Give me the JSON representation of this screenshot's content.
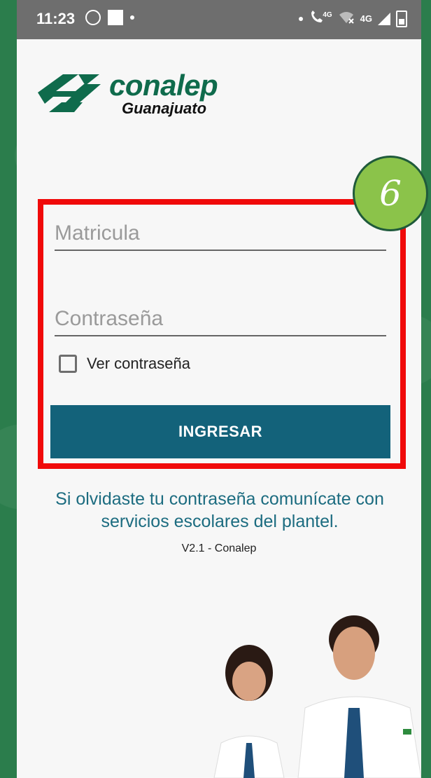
{
  "status_bar": {
    "time": "11:23",
    "network_label_1": "4G",
    "network_label_2": "4G",
    "icons": [
      "whatsapp-icon",
      "notification-square-icon",
      "volte-icon",
      "wifi-off-icon",
      "signal-icon",
      "battery-icon"
    ]
  },
  "logo": {
    "name": "conalep",
    "subtitle": "Guanajuato"
  },
  "annotation": {
    "badge_text": "6"
  },
  "form": {
    "matricula_placeholder": "Matricula",
    "password_placeholder": "Contraseña",
    "show_password_label": "Ver contraseña",
    "submit_label": "INGRESAR"
  },
  "footer": {
    "help_text": "Si olvidaste tu contraseña comunícate con servicios escolares del plantel.",
    "version": "V2.1 - Conalep"
  },
  "colors": {
    "brand_green": "#0f6b4c",
    "button": "#13627a",
    "help_text": "#1c6c80",
    "highlight": "#f00a0a",
    "badge": "#8bc34a"
  }
}
